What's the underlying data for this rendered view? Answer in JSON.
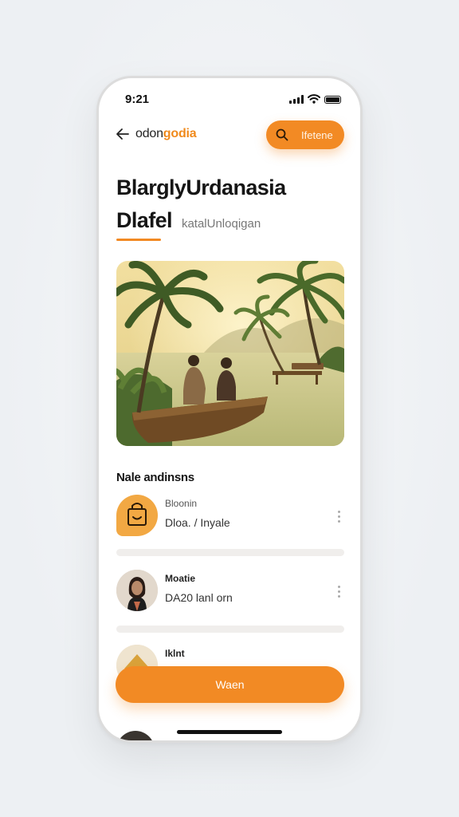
{
  "status_bar": {
    "time": "9:21"
  },
  "nav": {
    "brand_plain": "odon",
    "brand_accent": "godia",
    "action_label": "Ifetene"
  },
  "header": {
    "title_line1": "BlarglyUrdanasia",
    "title_line2": "Dlafel",
    "subtitle": "katalUnloqigan"
  },
  "section": {
    "title": "Nale andinsns"
  },
  "list": [
    {
      "name": "Bloonin",
      "detail": "Dloa. / Inyale"
    },
    {
      "name": "Moatie",
      "detail": "DA20 lanl orn"
    },
    {
      "name": "Iklnt",
      "detail": ""
    }
  ],
  "cta": {
    "label": "Waen"
  },
  "colors": {
    "accent": "#f28a24",
    "accent_text": "#f08a1c",
    "background": "#eef1f4"
  },
  "icons": [
    "back-arrow-icon",
    "search-icon",
    "shopping-bag-icon",
    "more-vertical-icon"
  ]
}
